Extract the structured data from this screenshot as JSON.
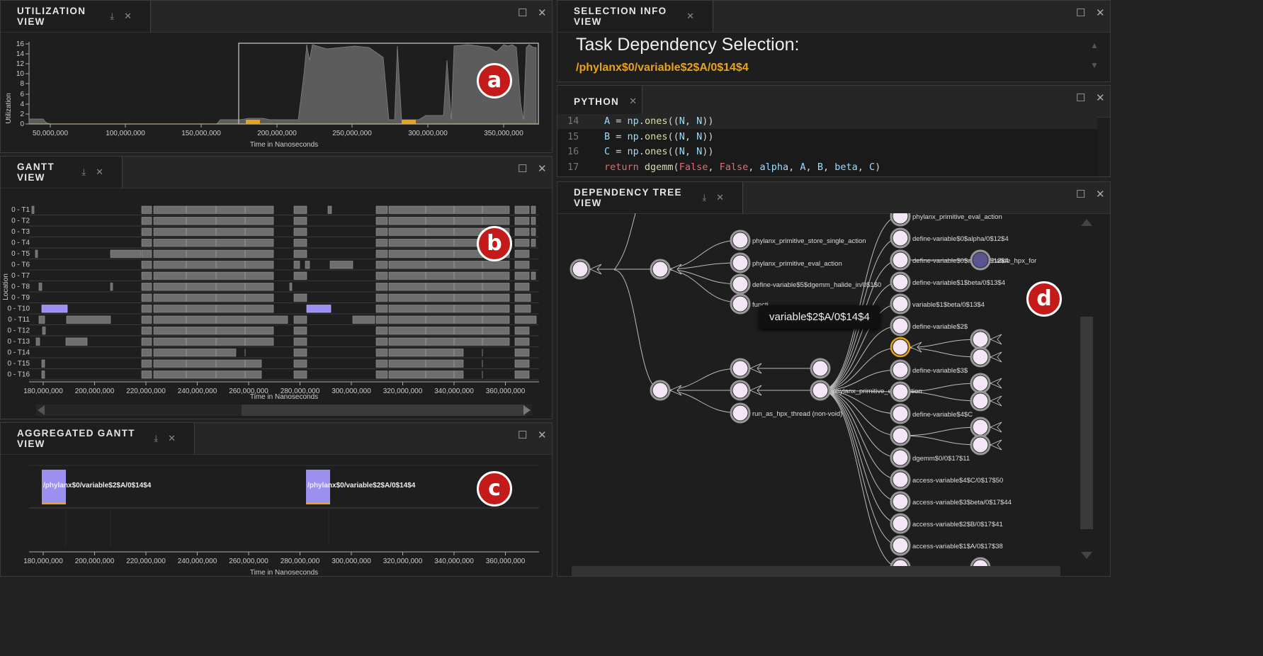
{
  "panels": {
    "utilization": {
      "title": "UTILIZATION VIEW"
    },
    "gantt": {
      "title": "GANTT VIEW"
    },
    "aggregated": {
      "title": "AGGREGATED GANTT VIEW"
    },
    "selection": {
      "title": "SELECTION INFO VIEW",
      "heading": "Task Dependency Selection:",
      "path": "/phylanx$0/variable$2$A/0$14$4"
    },
    "python": {
      "title": "PYTHON"
    },
    "tree": {
      "title": "DEPENDENCY TREE VIEW",
      "tooltip": "variable$2$A/0$14$4"
    }
  },
  "icons": {
    "download": "download-icon",
    "close": "close-icon",
    "maximize": "maximize-icon"
  },
  "badges": [
    "a",
    "b",
    "c",
    "d"
  ],
  "colors": {
    "accent": "#e8a317",
    "selection": "#9b8ff0",
    "bar": "#6e6e6e",
    "node": "#f5e6f7"
  },
  "utilization_chart": {
    "ylabel": "Utilization",
    "xlabel": "Time in Nanoseconds",
    "y_ticks": [
      "0",
      "2",
      "4",
      "6",
      "8",
      "10",
      "12",
      "14",
      "16"
    ],
    "x_ticks": [
      "50,000,000",
      "100,000,000",
      "150,000,000",
      "200,000,000",
      "250,000,000",
      "300,000,000",
      "350,000,000"
    ]
  },
  "gantt_chart": {
    "ylabel": "Location",
    "xlabel": "Time in Nanoseconds",
    "rows": [
      "0 - T1",
      "0 - T2",
      "0 - T3",
      "0 - T4",
      "0 - T5",
      "0 - T6",
      "0 - T7",
      "0 - T8",
      "0 - T9",
      "0 - T10",
      "0 - T11",
      "0 - T12",
      "0 - T13",
      "0 - T14",
      "0 - T15",
      "0 - T16"
    ],
    "x_ticks": [
      "180,000,000",
      "200,000,000",
      "220,000,000",
      "240,000,000",
      "260,000,000",
      "280,000,000",
      "300,000,000",
      "320,000,000",
      "340,000,000",
      "360,000,000"
    ]
  },
  "aggregated_chart": {
    "xlabel": "Time in Nanoseconds",
    "bar_labels": [
      "/phylanx$0/variable$2$A/0$14$4",
      "/phylanx$0/variable$2$A/0$14$4"
    ],
    "x_ticks": [
      "180,000,000",
      "200,000,000",
      "220,000,000",
      "240,000,000",
      "260,000,000",
      "280,000,000",
      "300,000,000",
      "320,000,000",
      "340,000,000",
      "360,000,000"
    ]
  },
  "code": {
    "lines": [
      {
        "num": "14",
        "parts": [
          [
            "v",
            "A"
          ],
          [
            "o",
            " = "
          ],
          [
            "v",
            "np"
          ],
          [
            "o",
            "."
          ],
          [
            "f",
            "ones"
          ],
          [
            "o",
            "(("
          ],
          [
            "v",
            "N"
          ],
          [
            "o",
            ", "
          ],
          [
            "v",
            "N"
          ],
          [
            "o",
            "))"
          ]
        ]
      },
      {
        "num": "15",
        "parts": [
          [
            "v",
            "B"
          ],
          [
            "o",
            " = "
          ],
          [
            "v",
            "np"
          ],
          [
            "o",
            "."
          ],
          [
            "f",
            "ones"
          ],
          [
            "o",
            "(("
          ],
          [
            "v",
            "N"
          ],
          [
            "o",
            ", "
          ],
          [
            "v",
            "N"
          ],
          [
            "o",
            "))"
          ]
        ]
      },
      {
        "num": "16",
        "parts": [
          [
            "v",
            "C"
          ],
          [
            "o",
            " = "
          ],
          [
            "v",
            "np"
          ],
          [
            "o",
            "."
          ],
          [
            "f",
            "ones"
          ],
          [
            "o",
            "(("
          ],
          [
            "v",
            "N"
          ],
          [
            "o",
            ", "
          ],
          [
            "v",
            "N"
          ],
          [
            "o",
            "))"
          ]
        ]
      },
      {
        "num": "17",
        "parts": [
          [
            "k",
            "return "
          ],
          [
            "f",
            "dgemm"
          ],
          [
            "o",
            "("
          ],
          [
            "k",
            "False"
          ],
          [
            "o",
            ", "
          ],
          [
            "k",
            "False"
          ],
          [
            "o",
            ", "
          ],
          [
            "v",
            "alpha"
          ],
          [
            "o",
            ", "
          ],
          [
            "v",
            "A"
          ],
          [
            "o",
            ", "
          ],
          [
            "v",
            "B"
          ],
          [
            "o",
            ", "
          ],
          [
            "v",
            "beta"
          ],
          [
            "o",
            ", "
          ],
          [
            "v",
            "C"
          ],
          [
            "o",
            ")"
          ]
        ]
      }
    ]
  },
  "tree_labels": {
    "n1": "phylanx_primitive_store_single_action",
    "n2": "phylanx_primitive_eval_action",
    "n3": "define-variable$5$dgemm_halide_in/0$1$0",
    "n4": "functi",
    "n5": "phylanx_primitive_eval_action",
    "n6": "run_as_hpx_thread (non-void)",
    "r0": "phylanx_primitive_eval_action",
    "r1": "define-variable$0$alpha/0$12$4",
    "r2": "halide_hpx_for",
    "r3": "define-variable$1$beta/0$13$4",
    "r4": "variable$1$beta/0$13$4",
    "r5": "define-variable$2$",
    "r6": "define-variable$3$",
    "r7": "define-variable$4$C",
    "r8": "dgemm$0/0$17$11",
    "r9": "access-variable$4$C/0$17$50",
    "r10": "access-variable$3$beta/0$17$44",
    "r11": "access-variable$2$B/0$17$41",
    "r12": "access-variable$1$A/0$17$38"
  }
}
